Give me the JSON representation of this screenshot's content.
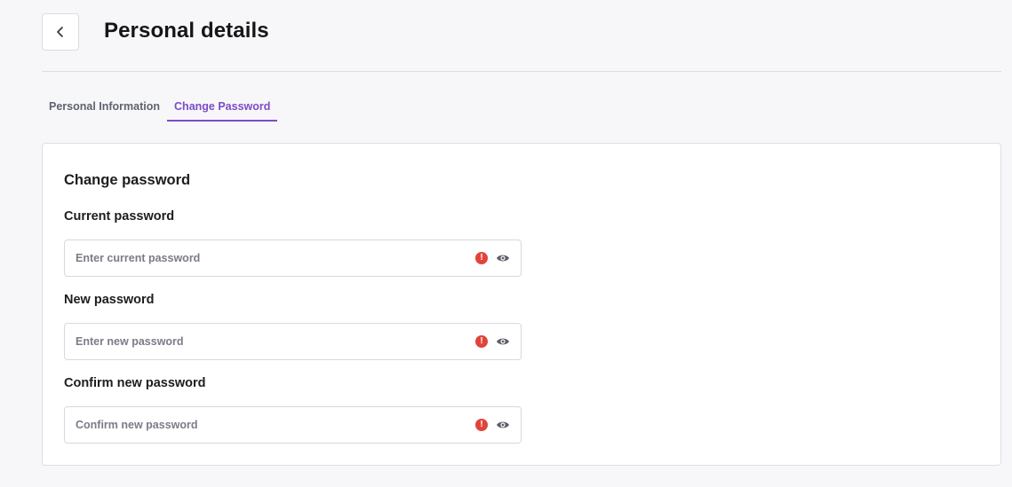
{
  "header": {
    "title": "Personal details",
    "back_icon": "chevron-left-icon"
  },
  "tabs": [
    {
      "label": "Personal Information",
      "active": false
    },
    {
      "label": "Change Password",
      "active": true
    }
  ],
  "colors": {
    "accent": "#7b4cc6",
    "error": "#e0443a",
    "background": "#f7f7f9"
  },
  "form": {
    "title": "Change password",
    "fields": [
      {
        "label": "Current password",
        "value": "",
        "placeholder": "Enter current password",
        "status_icon": "error-icon",
        "toggle_icon": "eye-icon"
      },
      {
        "label": "New password",
        "value": "",
        "placeholder": "Enter new password",
        "status_icon": "error-icon",
        "toggle_icon": "eye-icon"
      },
      {
        "label": "Confirm new password",
        "value": "",
        "placeholder": "Confirm new password",
        "status_icon": "error-icon",
        "toggle_icon": "eye-icon"
      }
    ]
  }
}
